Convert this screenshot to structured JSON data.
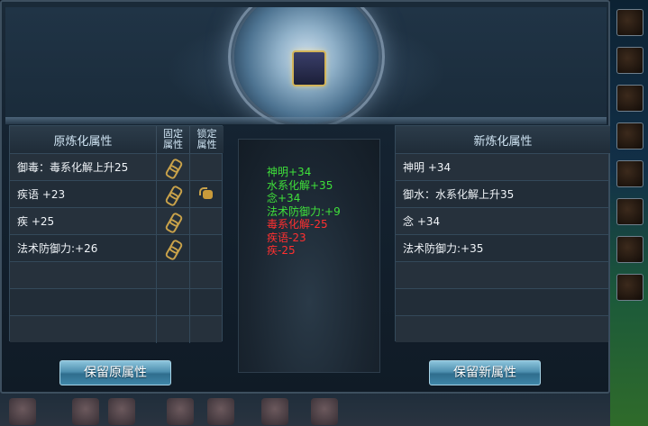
{
  "left_table": {
    "title": "原炼化属性",
    "col_fixed": [
      "固定",
      "属性"
    ],
    "col_lock": [
      "锁定",
      "属性"
    ],
    "rows": [
      {
        "text": "御毒：毒系化解上升25",
        "fixed": true,
        "locked": false
      },
      {
        "text": "疾语 +23",
        "fixed": true,
        "locked": true
      },
      {
        "text": "疾 +25",
        "fixed": true,
        "locked": false
      },
      {
        "text": "法术防御力:+26",
        "fixed": true,
        "locked": false
      },
      {
        "text": "",
        "fixed": false,
        "locked": false
      },
      {
        "text": "",
        "fixed": false,
        "locked": false
      },
      {
        "text": "",
        "fixed": false,
        "locked": false
      }
    ]
  },
  "right_table": {
    "title": "新炼化属性",
    "rows": [
      "神明 +34",
      "御水：水系化解上升35",
      "念 +34",
      "法术防御力:+35",
      "",
      "",
      ""
    ]
  },
  "comparison": {
    "lines": [
      {
        "text": "神明+34",
        "kind": "gain"
      },
      {
        "text": "水系化解+35",
        "kind": "gain"
      },
      {
        "text": "念+34",
        "kind": "gain"
      },
      {
        "text": "法术防御力:+9",
        "kind": "gain"
      },
      {
        "text": "毒系化解-25",
        "kind": "loss"
      },
      {
        "text": "疾语-23",
        "kind": "loss"
      },
      {
        "text": "疾-25",
        "kind": "loss"
      }
    ]
  },
  "buttons": {
    "keep_old": "保留原属性",
    "keep_new": "保留新属性"
  },
  "colors": {
    "gain": "#3fe03a",
    "loss": "#ff3030",
    "button": "#4e90b0"
  },
  "icons": {
    "fixed": "chain-icon",
    "lock": "lock-icon",
    "item": "equipment-item-icon"
  }
}
